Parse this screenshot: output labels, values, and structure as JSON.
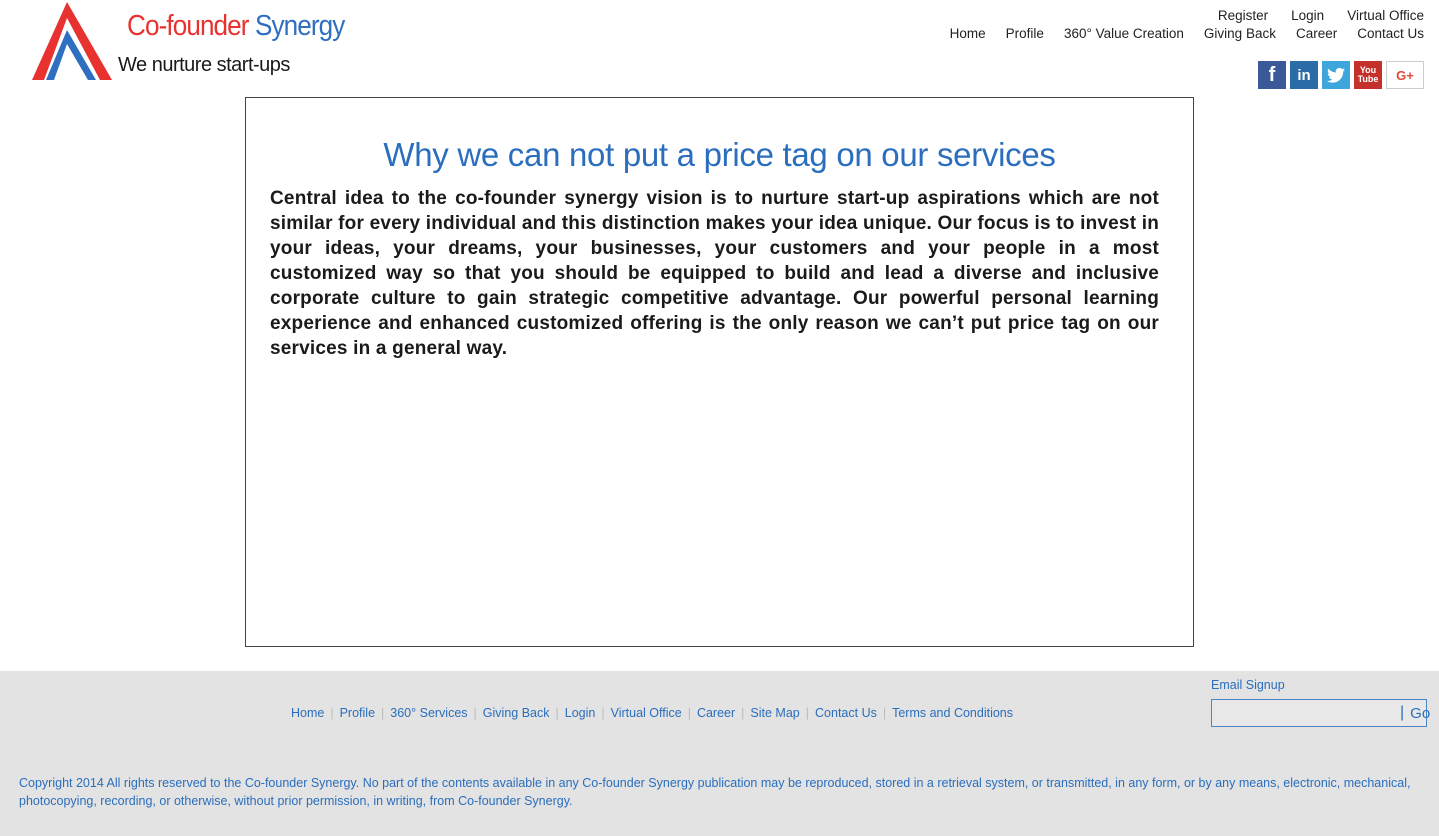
{
  "logo": {
    "title_part1": "Co-founder",
    "title_part2": "Synergy",
    "tagline": "We nurture start-ups",
    "colors": {
      "red": "#e8322f",
      "blue": "#2f6fbf"
    }
  },
  "nav_top": [
    "Register",
    "Login",
    "Virtual Office"
  ],
  "nav_main": [
    "Home",
    "Profile",
    "360° Value Creation",
    "Giving Back",
    "Career",
    "Contact Us"
  ],
  "social": [
    {
      "name": "facebook-icon",
      "glyph": "f"
    },
    {
      "name": "linkedin-icon",
      "glyph": "in"
    },
    {
      "name": "twitter-icon",
      "glyph": "🐦"
    },
    {
      "name": "youtube-icon",
      "glyph": "You Tube"
    },
    {
      "name": "google-plus-icon",
      "glyph": "G+"
    }
  ],
  "main": {
    "title": "Why we can not put a price tag on our services",
    "body": "Central idea to the co-founder synergy vision is to nurture start-up aspirations which are not similar for every individual and this distinction makes your idea unique. Our focus is to invest in your ideas, your dreams, your businesses, your customers and your people in a most customized way so that you should be equipped to build and lead a diverse and inclusive corporate culture to gain strategic competitive advantage. Our powerful personal learning experience and enhanced customized offering is the only reason we can’t put price tag on our services in a general way."
  },
  "footer": {
    "links": [
      "Home",
      "Profile",
      "360° Services",
      "Giving Back",
      "Login",
      "Virtual Office",
      "Career",
      "Site Map",
      "Contact Us",
      "Terms and Conditions"
    ],
    "signup_label": "Email Signup",
    "signup_placeholder": "",
    "go_label": "Go",
    "copyright": "Copyright 2014 All rights reserved to the Co-founder Synergy. No part of the contents available in any Co-founder Synergy publication may be reproduced, stored in a retrieval system, or transmitted, in any form, or by any means, electronic, mechanical, photocopying, recording, or otherwise, without prior permission, in writing, from Co-founder Synergy.",
    "accent_color": "#2a6ebd",
    "background": "#e3e3e3"
  }
}
